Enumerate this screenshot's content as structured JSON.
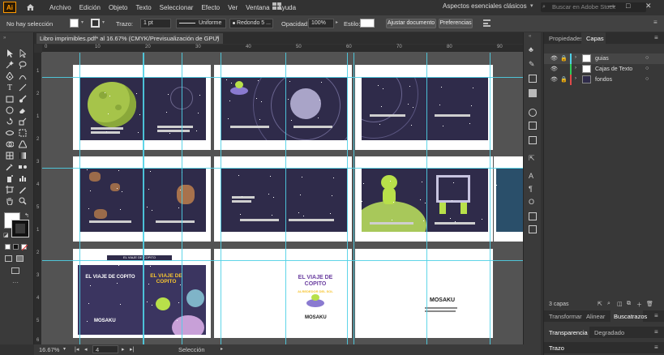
{
  "menubar": {
    "app_logo": "Ai",
    "items": [
      "Archivo",
      "Edición",
      "Objeto",
      "Texto",
      "Seleccionar",
      "Efecto",
      "Ver",
      "Ventana",
      "Ayuda"
    ],
    "workspace": "Aspectos esenciales clásicos",
    "stock_search_placeholder": "Buscar en Adobe Stock"
  },
  "controlbar": {
    "selection_status": "No hay selección",
    "stroke_label": "Trazo:",
    "stroke_weight": "1 pt",
    "stroke_profile": "Uniforme",
    "brush": "Redondo 5 ...",
    "opacity_label": "Opacidad:",
    "opacity_value": "100%",
    "style_label": "Estilo:",
    "adjust_document": "Ajustar documento",
    "preferences": "Preferencias"
  },
  "document": {
    "tab_title": "Libro imprimibles.pdf* al 16.67% (CMYK/Previsualización de GPU)"
  },
  "ruler": {
    "top_ticks": [
      "0",
      "10",
      "20",
      "30",
      "40",
      "50",
      "60",
      "70",
      "80",
      "90"
    ],
    "left_ticks": [
      "1",
      "2",
      "1",
      "2",
      "3",
      "4",
      "5",
      "1",
      "2",
      "3",
      "4",
      "5",
      "6"
    ]
  },
  "book": {
    "cover_top_title": "EL VIAJE DE COPITO",
    "cover_left_title": "EL VIAJE DE COPITO",
    "cover_right_title": "EL VIAJE DE COPITO",
    "cover_right_subtitle": "ALREDEDOR DEL SOL",
    "brand": "MOSAKU",
    "colors": {
      "space_dark": "#2f2b4a",
      "alien_green": "#b8e04a",
      "title_purple": "#6b3fa0",
      "title_yellow": "#f6c431",
      "guide_cyan": "#4fd0e6"
    }
  },
  "statusbar": {
    "zoom": "16.67%",
    "artboard": "4",
    "tool": "Selección"
  },
  "panels": {
    "tabs": [
      "Propiedades",
      "Capas"
    ],
    "active_tab": "Capas",
    "layers": [
      {
        "name": "guias",
        "locked": true
      },
      {
        "name": "Cajas de Texto",
        "locked": false
      },
      {
        "name": "fondos",
        "locked": true
      }
    ],
    "layer_count": "3 capas",
    "bottom_tabs": [
      "Transformar",
      "Alinear",
      "Buscatrazos"
    ],
    "bottom_active": "Buscatrazos",
    "transparency_tabs": [
      "Transparencia",
      "Degradado"
    ],
    "stroke_panel": "Trazo"
  }
}
